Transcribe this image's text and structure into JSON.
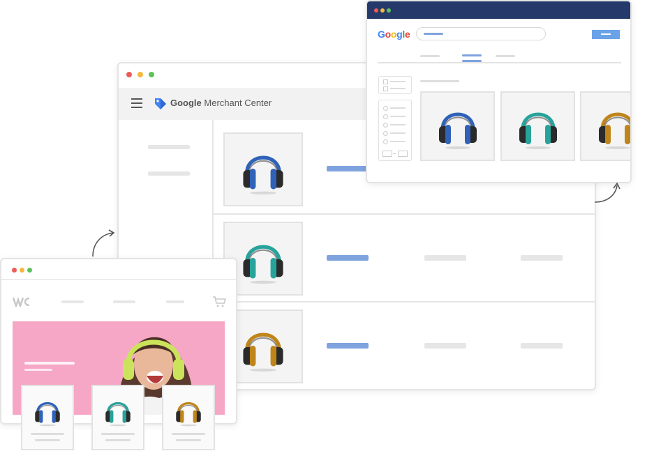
{
  "merchant": {
    "brand_name": "Google Merchant Center",
    "brand_bold": "Google",
    "brand_light": "Merchant Center"
  },
  "search": {
    "logo": "Google",
    "logo_colors": [
      "#4285F4",
      "#EA4335",
      "#FBBC05",
      "#4285F4",
      "#34A853",
      "#EA4335"
    ],
    "header_color": "#253a6b"
  },
  "products": [
    {
      "name": "blue-headphones",
      "color": "#2f62b8"
    },
    {
      "name": "teal-headphones",
      "color": "#27a39b"
    },
    {
      "name": "amber-headphones",
      "color": "#c0851a"
    }
  ],
  "shop": {
    "hero_color": "#f7a8c8",
    "hero_headphones_color": "#cbe35a"
  },
  "accent_blue": "#7fa3de",
  "icons": [
    "hamburger-icon",
    "merchant-tag-icon",
    "cart-icon",
    "shop-logo-icon",
    "arrow-icon"
  ]
}
